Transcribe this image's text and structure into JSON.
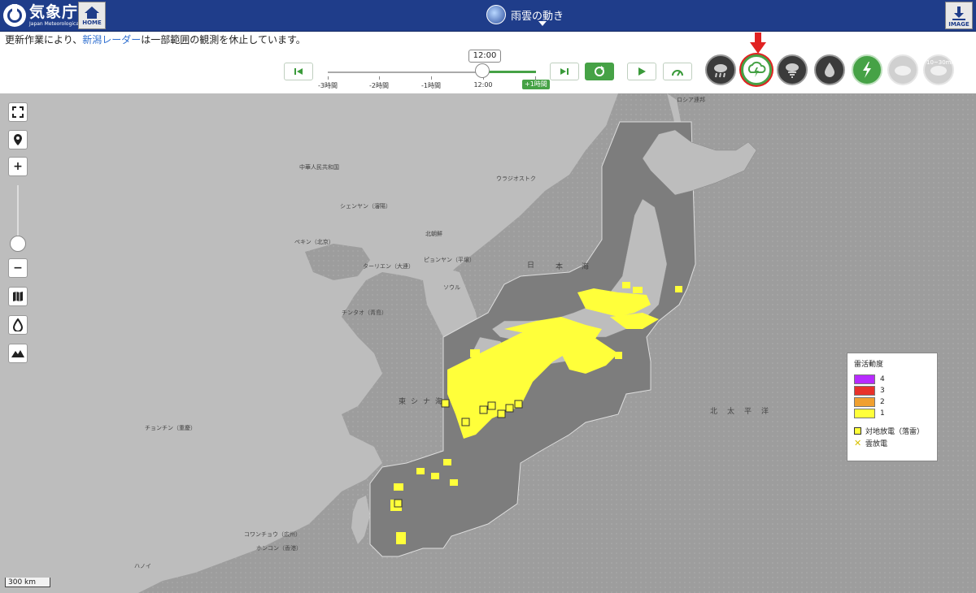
{
  "header": {
    "logo_jp": "気象庁",
    "logo_en": "Japan Meteorological Agency",
    "home_label": "HOME",
    "title": "雨雲の動き",
    "image_label": "IMAGE"
  },
  "notice": {
    "prefix": "更新作業により、",
    "link": "新潟レーダー",
    "suffix": "は一部範囲の観測を休止しています。"
  },
  "timeline": {
    "current_time": "12:00",
    "ticks": [
      "-3時間",
      "-2時間",
      "-1時間",
      "12:00"
    ],
    "plus_label": "+1時間"
  },
  "controls": {
    "first": "first-frame",
    "last": "last-frame",
    "refresh": "refresh",
    "play": "play",
    "speed": "speed"
  },
  "layers": [
    {
      "name": "rain-cloud",
      "state": "off"
    },
    {
      "name": "thunder-cloud",
      "state": "selected"
    },
    {
      "name": "tornado",
      "state": "off"
    },
    {
      "name": "rain-drop",
      "state": "off"
    },
    {
      "name": "lightning",
      "state": "on"
    },
    {
      "name": "cloud-1",
      "state": "disabled"
    },
    {
      "name": "cloud-2",
      "state": "disabled"
    }
  ],
  "layer_badge": "10~30min",
  "map": {
    "labels": [
      "ロシア連邦",
      "中華人民共和国",
      "ウラジオストク",
      "シェンヤン（瀋陽）",
      "北朝鮮",
      "ペキン（北京）",
      "ターリエン（大連）",
      "ピョンヤン（平壌）",
      "ソウル",
      "チンタオ（青島）",
      "日",
      "本",
      "海",
      "東シナ海",
      "チョンチン（重慶）",
      "北太平洋",
      "コワンチョウ（広州）",
      "ホンコン（香港）",
      "ハノイ"
    ],
    "scale": "300 km"
  },
  "legend": {
    "title": "雷活動度",
    "levels": [
      {
        "value": "4",
        "color": "#b72bff"
      },
      {
        "value": "3",
        "color": "#e8312a"
      },
      {
        "value": "2",
        "color": "#f0a030"
      },
      {
        "value": "1",
        "color": "#ffff3a"
      }
    ],
    "ground_strike": "対地放電（落雷）",
    "cloud_discharge": "雲放電"
  }
}
